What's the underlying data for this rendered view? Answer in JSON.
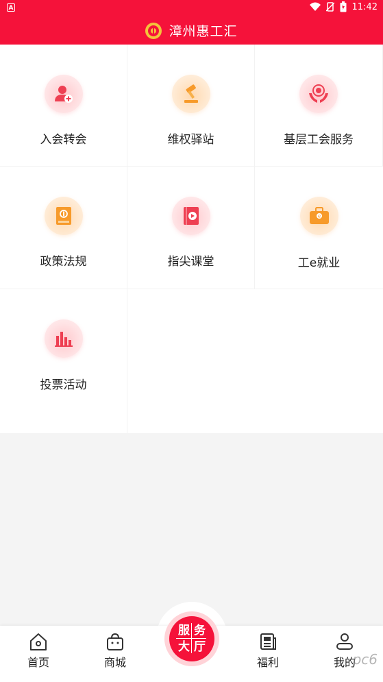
{
  "status_bar": {
    "left_icon": "A",
    "time": "11:42"
  },
  "header": {
    "title": "漳州惠工汇",
    "logo": "union-logo"
  },
  "services": [
    {
      "label": "入会转会",
      "icon": "user-add-icon",
      "tone": "pink"
    },
    {
      "label": "维权驿站",
      "icon": "gavel-icon",
      "tone": "orange"
    },
    {
      "label": "基层工会服务",
      "icon": "hands-emblem-icon",
      "tone": "pink"
    },
    {
      "label": "政策法规",
      "icon": "policy-book-icon",
      "tone": "orange"
    },
    {
      "label": "指尖课堂",
      "icon": "video-book-icon",
      "tone": "pink"
    },
    {
      "label": "工e就业",
      "icon": "briefcase-icon",
      "tone": "orange"
    },
    {
      "label": "投票活动",
      "icon": "bar-chart-icon",
      "tone": "pink"
    }
  ],
  "bottom_nav": {
    "home": "首页",
    "mall": "商城",
    "center_button": [
      "服",
      "务",
      "大",
      "厅"
    ],
    "welfare": "福利",
    "mine": "我的"
  },
  "watermark": "pc6",
  "colors": {
    "brand_red": "#f5123a",
    "icon_pink": "#f04a5a",
    "icon_orange": "#f7a23a"
  }
}
